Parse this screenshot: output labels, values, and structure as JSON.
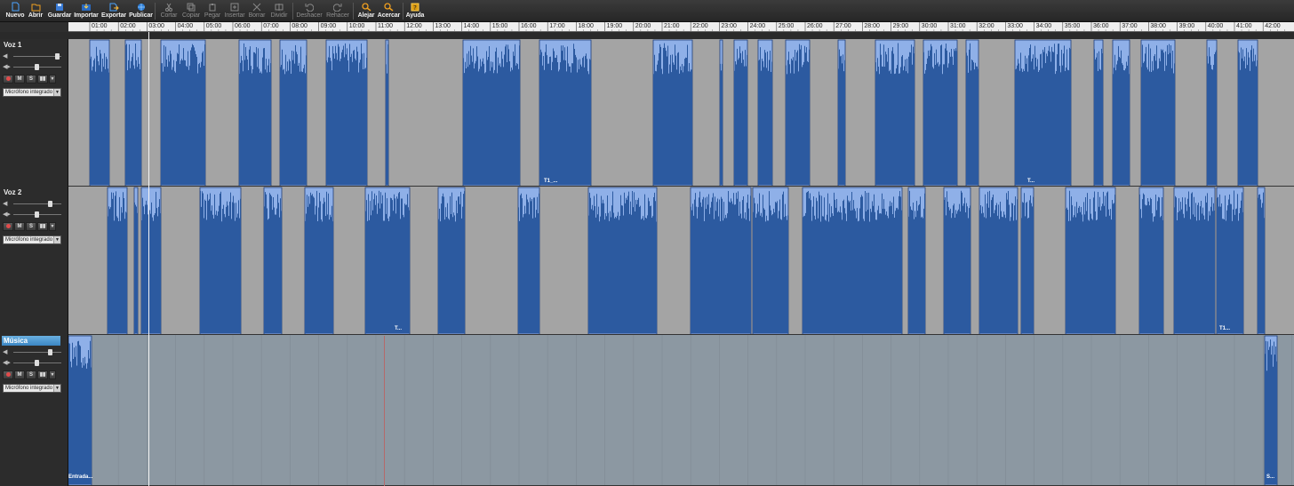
{
  "toolbar": {
    "nuevo": "Nuevo",
    "abrir": "Abrir",
    "guardar": "Guardar",
    "importar": "Importar",
    "exportar": "Exportar",
    "publicar": "Publicar",
    "cortar": "Cortar",
    "copiar": "Copiar",
    "pegar": "Pegar",
    "insertar": "Insertar",
    "borrar": "Borrar",
    "dividir": "Dividir",
    "deshacer": "Deshacer",
    "rehacer": "Rehacer",
    "alejar": "Alejar",
    "acercar": "Acercar",
    "ayuda": "Ayuda"
  },
  "ruler": {
    "ticks": [
      "01:00",
      "02:00",
      "03:00",
      "04:00",
      "05:00",
      "06:00",
      "07:00",
      "08:00",
      "09:00",
      "10:00",
      "11:00",
      "12:00",
      "13:00",
      "14:00",
      "15:00",
      "16:00",
      "17:00",
      "18:00",
      "19:00",
      "20:00",
      "21:00",
      "22:00",
      "23:00",
      "24:00",
      "25:00",
      "26:00",
      "27:00",
      "28:00",
      "29:00",
      "30:00",
      "31:00",
      "32:00",
      "33:00",
      "34:00",
      "35:00",
      "36:00",
      "37:00",
      "38:00",
      "39:00",
      "40:00",
      "41:00",
      "42:00"
    ]
  },
  "tracks": [
    {
      "name": "Voz 1",
      "input": "Micrófono integrado",
      "volume": 0.9,
      "pan": 0.5,
      "clip_labels": [
        "T1_...",
        "T..."
      ]
    },
    {
      "name": "Voz 2",
      "input": "Micrófono integrado",
      "volume": 0.75,
      "pan": 0.5,
      "clip_labels": [
        "T...",
        "T1..."
      ]
    },
    {
      "name": "Música",
      "input": "Micrófono integrado",
      "volume": 0.75,
      "pan": 0.5,
      "clip_labels": [
        "Entrada...",
        "S..."
      ]
    }
  ],
  "buttons": {
    "m": "M",
    "s": "S"
  },
  "colors": {
    "accent": "#3b86c4",
    "waveform_dark": "#2c5aa0",
    "waveform_light": "#8fb0e8",
    "lane_voice": "#a4a4a4",
    "lane_music": "#8c98a2"
  },
  "icons": {
    "nuevo": "document-icon",
    "abrir": "folder-icon",
    "guardar": "save-icon",
    "importar": "import-icon",
    "exportar": "export-icon",
    "publicar": "globe-icon",
    "cortar": "scissors-icon",
    "copiar": "copy-icon",
    "pegar": "paste-icon",
    "insertar": "insert-icon",
    "borrar": "erase-icon",
    "dividir": "split-icon",
    "deshacer": "undo-icon",
    "rehacer": "redo-icon",
    "alejar": "zoom-out-icon",
    "acercar": "zoom-in-icon",
    "ayuda": "help-icon"
  }
}
